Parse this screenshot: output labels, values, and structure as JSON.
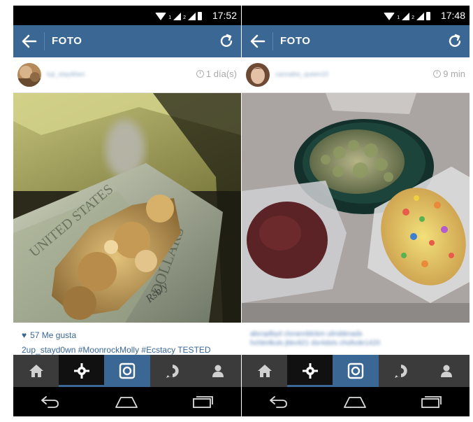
{
  "screens": [
    {
      "status": {
        "time": "17:52",
        "sim1": "1",
        "sim2": "2"
      },
      "appbar": {
        "title": "FOTO"
      },
      "post": {
        "username": "tuji_stayd0wn",
        "timestamp": "1 día(s)",
        "likes": "57 Me gusta",
        "caption": "2up_stayd0wn #MoonrockMolly #Ecstacy TESTED"
      }
    },
    {
      "status": {
        "time": "17:48",
        "sim1": "1",
        "sim2": "2"
      },
      "appbar": {
        "title": "FOTO"
      },
      "post": {
        "username": "cannabis_queen15",
        "timestamp": "9 min",
        "caption_lines": [
          "abcoplbyd clorannblckm ulirsbknads",
          "hchbnlkuls jbkv921 dsr4dsts chsllvde1420"
        ]
      }
    }
  ],
  "colors": {
    "accent": "#3a6794",
    "tabbar": "#3b3b3b",
    "status": "#000000"
  },
  "icons": [
    "back-arrow-icon",
    "refresh-icon",
    "clock-icon",
    "heart-icon",
    "home-icon",
    "explore-icon",
    "camera-icon",
    "activity-icon",
    "profile-icon",
    "nav-back-icon",
    "nav-home-icon",
    "nav-recents-icon"
  ]
}
